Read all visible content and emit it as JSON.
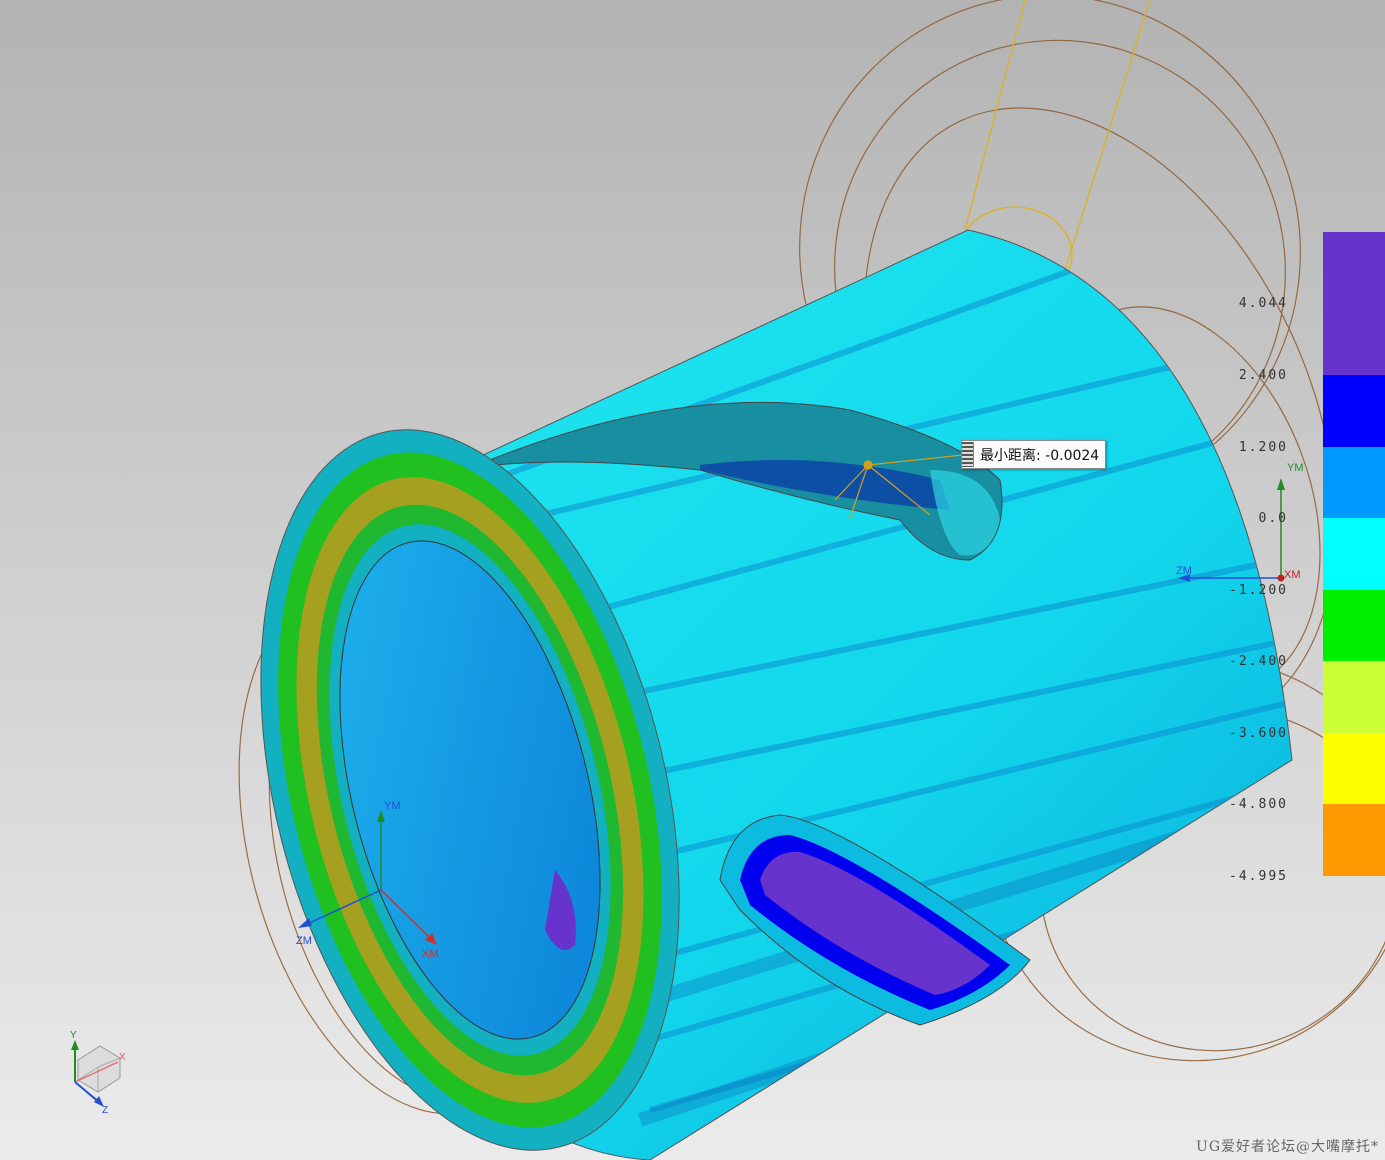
{
  "viewport": {
    "tooltip": {
      "label": "最小距离: -0.0024"
    },
    "legend": {
      "labels": [
        "4.044",
        "2.400",
        "1.200",
        "0.0",
        "-1.200",
        "-2.400",
        "-3.600",
        "-4.800",
        "-4.995"
      ],
      "colors": [
        "#6633cc",
        "#0000ff",
        "#0099ff",
        "#00ffff",
        "#00ee00",
        "#ccff33",
        "#ffff00",
        "#ff9900"
      ]
    },
    "triad_front": {
      "y": "YM",
      "z": "ZM",
      "x": "XM"
    },
    "triad_right": {
      "y": "YM",
      "z": "ZM",
      "x": "XM"
    },
    "view_triad": {
      "x": "X",
      "y": "Y",
      "z": "Z"
    },
    "watermark": "UG爱好者论坛@大嘴摩托*"
  }
}
